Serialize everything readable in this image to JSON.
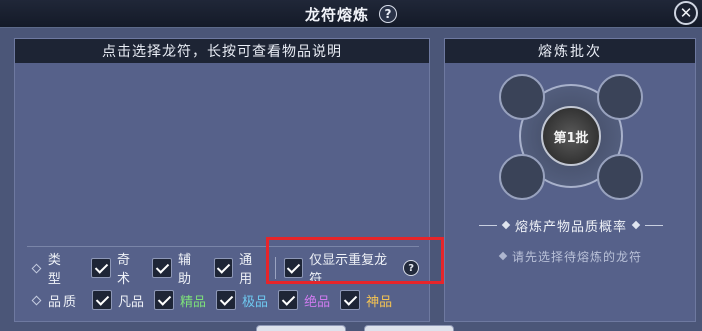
{
  "title": "龙符熔炼",
  "title_help": "?",
  "close_symbol": "✕",
  "left_panel": {
    "header": "点击选择龙符，长按可查看物品说明",
    "type_row": {
      "label": "类型",
      "options": [
        "奇术",
        "辅助",
        "通用"
      ],
      "only_duplicates_label": "仅显示重复龙符",
      "only_duplicates_help": "?"
    },
    "quality_row": {
      "label": "品质",
      "options": [
        {
          "label": "凡品",
          "color": "#eef1f7"
        },
        {
          "label": "精品",
          "color": "#7de07a"
        },
        {
          "label": "极品",
          "color": "#6ec9f0"
        },
        {
          "label": "绝品",
          "color": "#d07cf0"
        },
        {
          "label": "神品",
          "color": "#f5c452"
        }
      ]
    }
  },
  "right_panel": {
    "header": "熔炼批次",
    "batch_label": "第1批",
    "probability_title": "熔炼产物品质概率",
    "probability_hint": "请先选择待熔炼的龙符"
  },
  "highlight_color": "#e6252a"
}
